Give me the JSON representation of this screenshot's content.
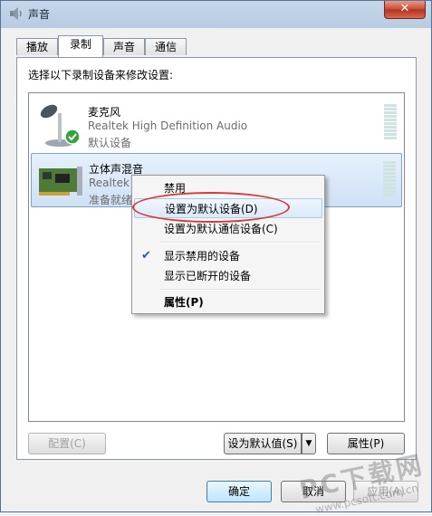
{
  "window": {
    "title": "声音",
    "close_label": "✕"
  },
  "tabs": [
    {
      "label": "播放"
    },
    {
      "label": "录制"
    },
    {
      "label": "声音"
    },
    {
      "label": "通信"
    }
  ],
  "panel": {
    "instruction": "选择以下录制设备来修改设置:",
    "devices": [
      {
        "name": "麦克风",
        "driver": "Realtek High Definition Audio",
        "status": "默认设备",
        "icon": "microphone-icon"
      },
      {
        "name": "立体声混音",
        "driver": "Realtek",
        "status": "准备就绪",
        "icon": "sound-card-icon"
      }
    ],
    "configure_label": "配置(C)",
    "set_default_label": "设为默认值(S)",
    "properties_label": "属性(P)"
  },
  "context_menu": {
    "items": [
      {
        "label": "禁用"
      },
      {
        "label": "设置为默认设备(D)"
      },
      {
        "label": "设置为默认通信设备(C)"
      },
      {
        "label": "显示禁用的设备",
        "checked": true
      },
      {
        "label": "显示已断开的设备"
      },
      {
        "label": "属性(P)",
        "bold": true
      }
    ]
  },
  "footer": {
    "ok_label": "确定",
    "cancel_label": "取消",
    "apply_label": "应用(A)"
  },
  "watermark": {
    "text": "PC下载网",
    "url": "www.pcsoft.com.cn"
  }
}
